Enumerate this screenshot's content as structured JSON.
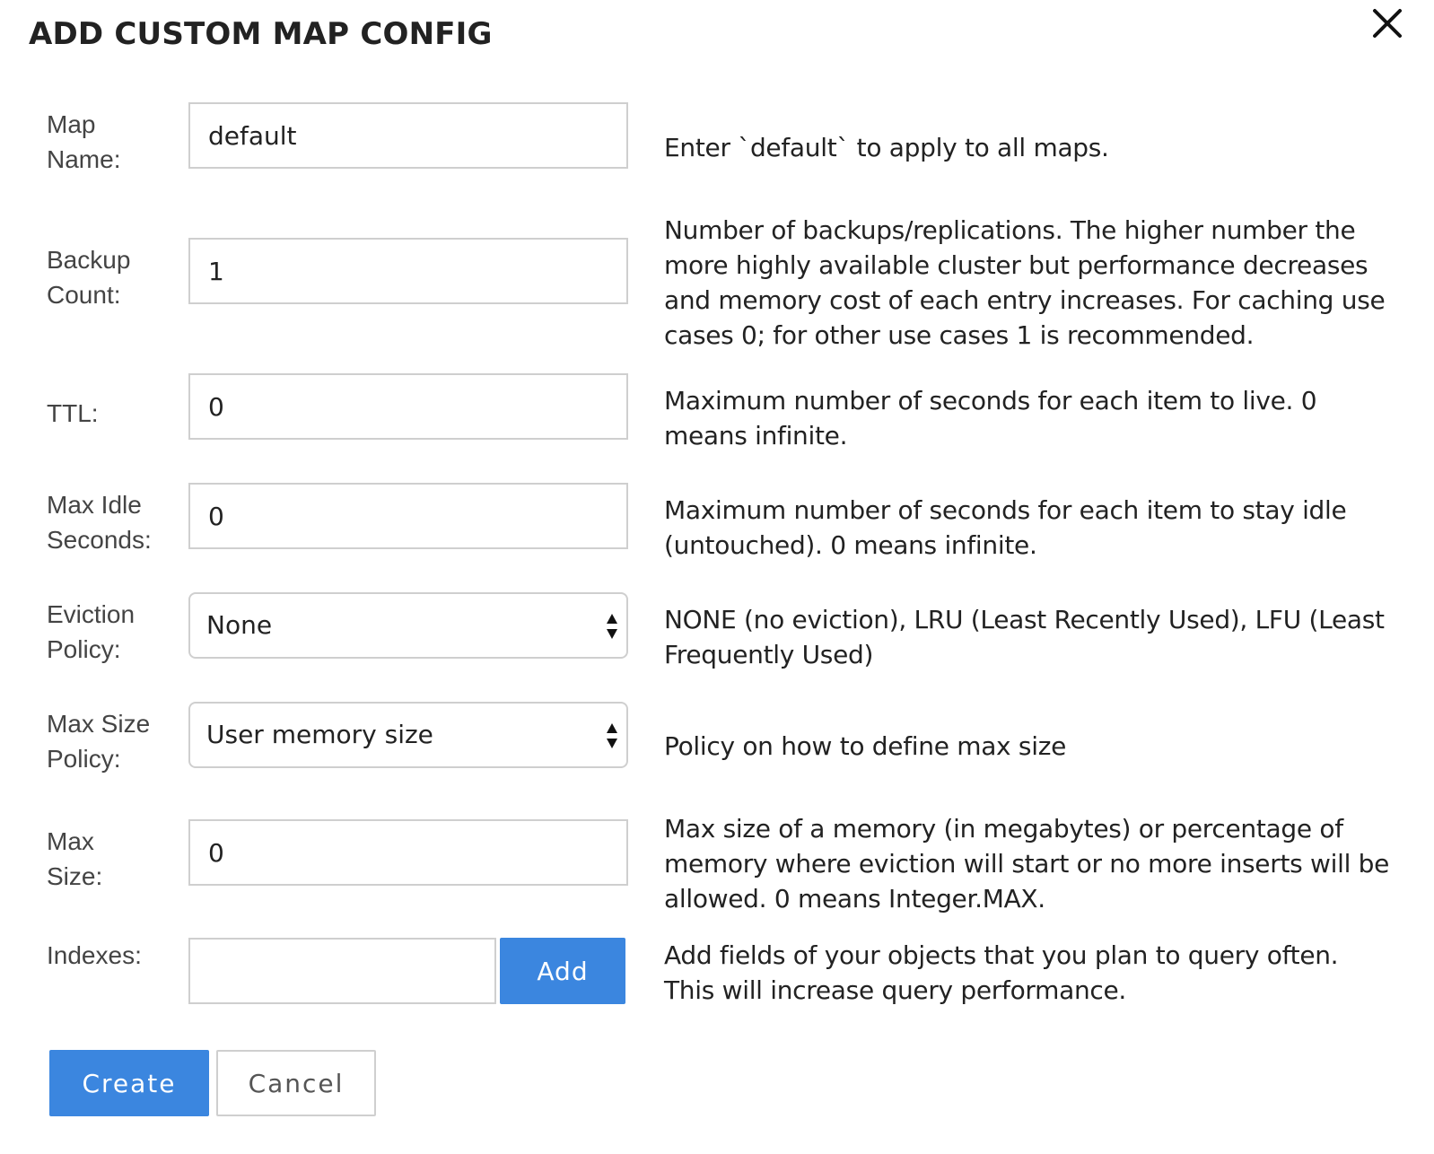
{
  "dialog": {
    "title": "ADD CUSTOM MAP CONFIG",
    "close_icon": "close-icon"
  },
  "form": {
    "map_name": {
      "label_line1": "Map",
      "label_line2": "Name:",
      "value": "default",
      "help": "Enter `default` to apply to all maps."
    },
    "backup_count": {
      "label_line1": "Backup",
      "label_line2": "Count:",
      "value": "1",
      "help": "Number of backups/replications. The higher number the more highly available cluster but performance decreases and memory cost of each entry increases. For caching use cases 0; for other use cases 1 is recommended."
    },
    "ttl": {
      "label": "TTL:",
      "value": "0",
      "help": "Maximum number of seconds for each item to live. 0 means infinite."
    },
    "max_idle": {
      "label_line1": "Max Idle",
      "label_line2": "Seconds:",
      "value": "0",
      "help": "Maximum number of seconds for each item to stay idle (untouched). 0 means infinite."
    },
    "eviction_policy": {
      "label_line1": "Eviction",
      "label_line2": "Policy:",
      "selected": "None",
      "help": "NONE (no eviction), LRU (Least Recently Used), LFU (Least Frequently Used)"
    },
    "max_size_policy": {
      "label_line1": "Max Size",
      "label_line2": "Policy:",
      "selected": "User memory size",
      "help": "Policy on how to define max size"
    },
    "max_size": {
      "label_line1": "Max",
      "label_line2": "Size:",
      "value": "0",
      "help": "Max size of a memory (in megabytes) or percentage of memory where eviction will start or no more inserts will be allowed. 0 means Integer.MAX."
    },
    "indexes": {
      "label": "Indexes:",
      "value": "",
      "add_label": "Add",
      "help": "Add fields of your objects that you plan to query often. This will increase query performance."
    }
  },
  "actions": {
    "create_label": "Create",
    "cancel_label": "Cancel"
  },
  "colors": {
    "primary": "#3b86df",
    "border": "#cfcfcf",
    "text": "#222222"
  }
}
